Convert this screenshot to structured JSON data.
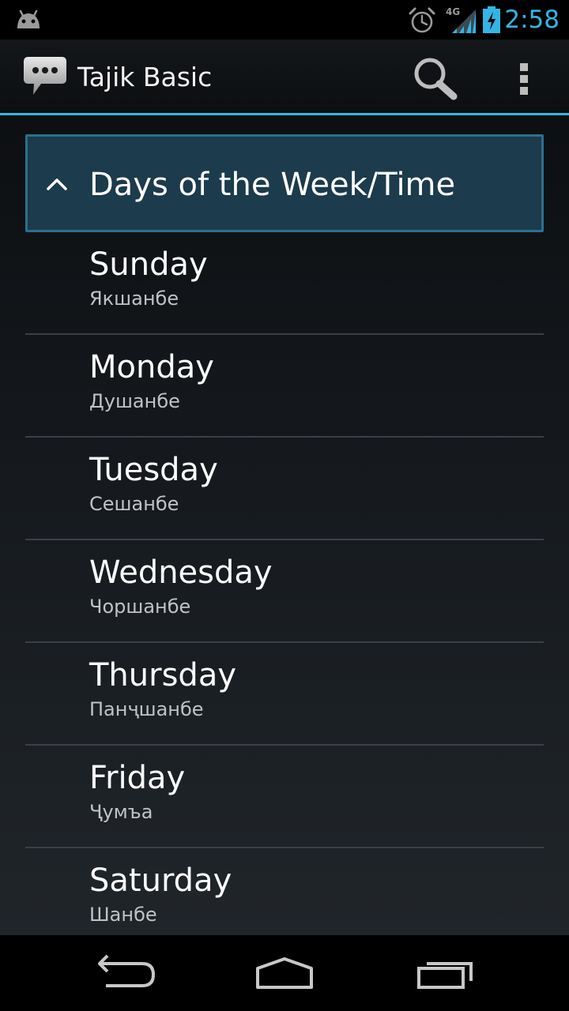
{
  "status_bar": {
    "network_label": "4G",
    "time": "2:58",
    "accent_color": "#33b5e5"
  },
  "action_bar": {
    "title": "Tajik Basic",
    "icons": {
      "app": "chat-bubble-icon",
      "search": "search-icon",
      "overflow": "overflow-menu-icon"
    }
  },
  "group": {
    "title": "Days of the Week/Time",
    "expanded": true,
    "highlight_color": "#1c3b4c"
  },
  "items": [
    {
      "english": "Sunday",
      "tajik": "Якшанбе"
    },
    {
      "english": "Monday",
      "tajik": "Душанбе"
    },
    {
      "english": "Tuesday",
      "tajik": "Сешанбе"
    },
    {
      "english": "Wednesday",
      "tajik": "Чоршанбе"
    },
    {
      "english": "Thursday",
      "tajik": "Панҷшанбе"
    },
    {
      "english": "Friday",
      "tajik": "Ҷумъа"
    },
    {
      "english": "Saturday",
      "tajik": "Шанбе"
    }
  ],
  "nav_bar": {
    "icons": [
      "back-icon",
      "home-icon",
      "recents-icon"
    ]
  }
}
